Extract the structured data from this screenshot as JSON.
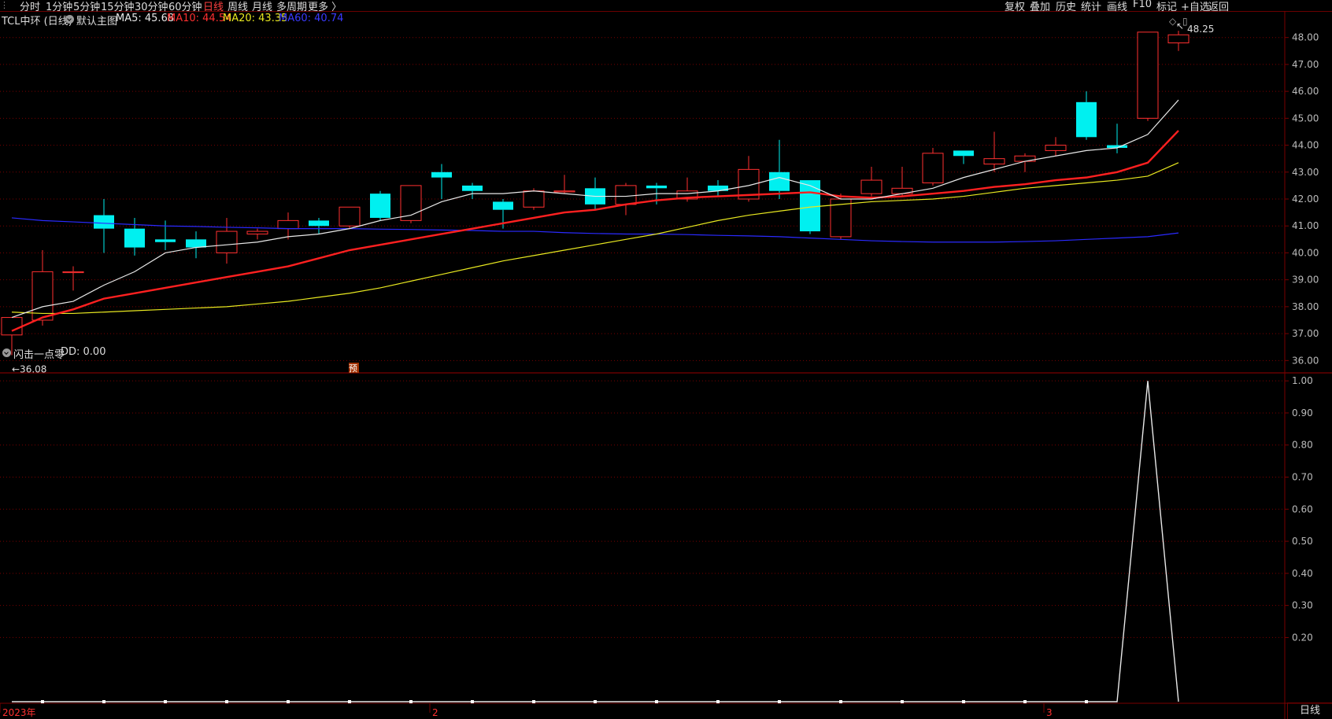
{
  "toolbar": {
    "left_items": [
      "分时",
      "1分钟",
      "5分钟",
      "15分钟",
      "30分钟",
      "60分钟",
      "日线",
      "周线",
      "月线",
      "多周期",
      "更多 〉"
    ],
    "active_item": "日线",
    "right_items": [
      "复权",
      "叠加",
      "历史",
      "统计",
      "画线",
      "F10",
      "标记",
      "+自选",
      "返回"
    ]
  },
  "main_chart": {
    "stock": "TCL中环 (日线)",
    "indicator": "默认主图",
    "ma5_label": "MA5: 45.68",
    "ma10_label": "MA10: 44.54",
    "ma20_label": "MA20: 43.35",
    "ma60_label": "MA60: 40.74",
    "colors": {
      "ma5": "#e8e8e8",
      "ma10": "#ff2020",
      "ma20": "#e8e820",
      "ma60": "#2a2aff",
      "up": "#ff3030",
      "down": "#00f0f0",
      "grid": "#7a0000"
    },
    "high_label": "48.25",
    "low_label": "36.08",
    "marker_text": "预",
    "ylim": [
      35.6,
      48.4
    ],
    "y_ticks": [
      "48.00",
      "47.00",
      "46.00",
      "45.00",
      "44.00",
      "43.00",
      "42.00",
      "41.00",
      "40.00",
      "39.00",
      "38.00",
      "37.00",
      "36.00"
    ],
    "y_tick_values": [
      48,
      47,
      46,
      45,
      44,
      43,
      42,
      41,
      40,
      39,
      38,
      37,
      36
    ],
    "candles": [
      [
        36.95,
        37.6,
        36.2,
        37.5
      ],
      [
        37.5,
        39.3,
        40.1,
        37.3
      ],
      [
        39.3,
        39.3,
        39.5,
        38.6
      ],
      [
        41.4,
        40.9,
        42.0,
        40.0
      ],
      [
        40.9,
        40.2,
        41.3,
        39.9
      ],
      [
        40.5,
        40.4,
        41.2,
        40.1
      ],
      [
        40.5,
        40.2,
        40.8,
        39.8
      ],
      [
        40.0,
        40.8,
        41.3,
        39.6
      ],
      [
        40.7,
        40.8,
        40.9,
        40.5
      ],
      [
        40.9,
        41.2,
        41.5,
        40.5
      ],
      [
        41.2,
        41.0,
        41.3,
        40.7
      ],
      [
        41.0,
        41.7,
        41.7,
        40.9
      ],
      [
        42.2,
        41.3,
        42.3,
        41.2
      ],
      [
        41.2,
        42.5,
        42.5,
        41.1
      ],
      [
        43.0,
        42.8,
        43.3,
        42.0
      ],
      [
        42.5,
        42.3,
        42.6,
        42.0
      ],
      [
        41.9,
        41.6,
        42.0,
        40.9
      ],
      [
        41.7,
        42.3,
        42.4,
        41.6
      ],
      [
        42.3,
        42.3,
        42.9,
        42.2
      ],
      [
        42.4,
        41.8,
        42.8,
        41.6
      ],
      [
        41.8,
        42.5,
        42.6,
        41.4
      ],
      [
        42.5,
        42.4,
        42.6,
        41.8
      ],
      [
        42.0,
        42.3,
        42.8,
        41.9
      ],
      [
        42.5,
        42.3,
        42.7,
        42.1
      ],
      [
        42.0,
        43.1,
        43.6,
        41.9
      ],
      [
        43.0,
        42.3,
        44.2,
        42.0
      ],
      [
        42.7,
        40.8,
        42.7,
        40.7
      ],
      [
        40.6,
        42.0,
        42.2,
        40.5
      ],
      [
        42.2,
        42.7,
        43.2,
        42.1
      ],
      [
        42.2,
        42.4,
        43.2,
        42.1
      ],
      [
        42.6,
        43.7,
        43.9,
        42.5
      ],
      [
        43.8,
        43.6,
        43.8,
        43.3
      ],
      [
        43.3,
        43.5,
        44.5,
        43.0
      ],
      [
        43.4,
        43.6,
        43.7,
        43.0
      ],
      [
        43.8,
        44.0,
        44.3,
        43.6
      ],
      [
        45.6,
        44.3,
        46.0,
        44.2
      ],
      [
        44.0,
        43.9,
        44.8,
        43.7
      ],
      [
        45.0,
        48.2,
        48.2,
        44.9
      ],
      [
        47.8,
        48.1,
        48.25,
        47.5
      ]
    ],
    "ma5": [
      37.6,
      38.0,
      38.2,
      38.8,
      39.3,
      40.0,
      40.2,
      40.3,
      40.4,
      40.6,
      40.7,
      40.9,
      41.2,
      41.4,
      41.9,
      42.2,
      42.2,
      42.3,
      42.2,
      42.1,
      42.1,
      42.2,
      42.2,
      42.3,
      42.5,
      42.8,
      42.5,
      42.0,
      42.0,
      42.2,
      42.4,
      42.8,
      43.1,
      43.4,
      43.6,
      43.8,
      43.9,
      44.4,
      45.68
    ],
    "ma10": [
      37.1,
      37.6,
      37.9,
      38.3,
      38.5,
      38.7,
      38.9,
      39.1,
      39.3,
      39.5,
      39.8,
      40.1,
      40.3,
      40.5,
      40.7,
      40.9,
      41.1,
      41.3,
      41.5,
      41.6,
      41.8,
      41.95,
      42.05,
      42.1,
      42.15,
      42.2,
      42.25,
      42.1,
      42.05,
      42.1,
      42.2,
      42.3,
      42.45,
      42.55,
      42.7,
      42.8,
      43.0,
      43.35,
      44.54
    ],
    "ma20": [
      37.8,
      37.75,
      37.75,
      37.8,
      37.85,
      37.9,
      37.95,
      38.0,
      38.1,
      38.2,
      38.35,
      38.5,
      38.7,
      38.95,
      39.2,
      39.45,
      39.7,
      39.9,
      40.1,
      40.3,
      40.5,
      40.7,
      40.95,
      41.2,
      41.4,
      41.55,
      41.7,
      41.8,
      41.9,
      41.95,
      42.0,
      42.1,
      42.25,
      42.4,
      42.5,
      42.6,
      42.7,
      42.85,
      43.35
    ],
    "ma60": [
      41.3,
      41.2,
      41.15,
      41.1,
      41.05,
      41.0,
      40.98,
      40.95,
      40.93,
      40.9,
      40.9,
      40.9,
      40.88,
      40.87,
      40.85,
      40.83,
      40.8,
      40.8,
      40.75,
      40.72,
      40.7,
      40.7,
      40.68,
      40.65,
      40.63,
      40.6,
      40.55,
      40.5,
      40.45,
      40.42,
      40.4,
      40.4,
      40.4,
      40.42,
      40.45,
      40.5,
      40.55,
      40.6,
      40.74
    ]
  },
  "sub_chart": {
    "indicator": "闪击一点零",
    "dd_label": "DD: 0.00",
    "ylim": [
      0,
      1.02
    ],
    "y_ticks": [
      "1.00",
      "0.90",
      "0.80",
      "0.70",
      "0.60",
      "0.50",
      "0.40",
      "0.30",
      "0.20"
    ],
    "y_tick_values": [
      1.0,
      0.9,
      0.8,
      0.7,
      0.6,
      0.5,
      0.4,
      0.3,
      0.2
    ],
    "values": [
      0,
      0,
      0,
      0,
      0,
      0,
      0,
      0,
      0,
      0,
      0,
      0,
      0,
      0,
      0,
      0,
      0,
      0,
      0,
      0,
      0,
      0,
      0,
      0,
      0,
      0,
      0,
      0,
      0,
      0,
      0,
      0,
      0,
      0,
      0,
      0,
      0,
      1,
      0
    ]
  },
  "x_axis": {
    "labels": [
      "2023年",
      "2",
      "3"
    ],
    "label_index": [
      0,
      14,
      34
    ],
    "period_label": "日线"
  }
}
